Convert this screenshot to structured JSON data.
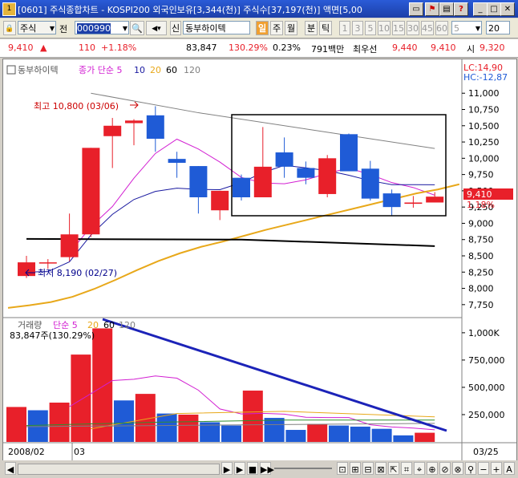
{
  "window": {
    "title": "[0601] 주식종합차트 - KOSPI200 외국인보유[3,344(천)] 주식수[37,197(천)] 액면[5,00",
    "icon": "1",
    "controls": [
      "_",
      "□",
      "✕"
    ],
    "extra_icons": [
      "restore-icon",
      "flag-icon",
      "print-icon",
      "help-icon",
      "minimize-icon"
    ]
  },
  "toolbar": {
    "market_select": "주식",
    "prefix_label": "전",
    "code_value": "000990",
    "search_icon": "magnifier-icon",
    "speaker_icon": "speaker-icon",
    "sin_label": "신",
    "stock_name": "동부하이텍",
    "period_buttons": [
      "일",
      "주",
      "월",
      "분",
      "틱"
    ],
    "active_period": "일",
    "interval_buttons": [
      "1",
      "3",
      "5",
      "10",
      "15",
      "30",
      "45",
      "60"
    ],
    "interval_select": "5",
    "count_value": "20"
  },
  "quote": {
    "price": "9,410",
    "arrow": "▲",
    "change": "110",
    "change_pct": "+1.18%",
    "volume": "83,847",
    "vol_ratio": "130.29%",
    "turnover": "0.23%",
    "amount": "791백만",
    "best_label": "최우선",
    "ask": "9,440",
    "bid": "9,410",
    "open_label": "시",
    "open": "9,320"
  },
  "chart": {
    "price_legend": {
      "name": "동부하이텍",
      "ma_label": "종가 단순 5",
      "ma_values": [
        "10",
        "20",
        "60",
        "120"
      ]
    },
    "vol_legend": {
      "name": "거래량",
      "ma_label": "단순 5",
      "ma_values": [
        "20",
        "60",
        "120"
      ],
      "info": "83,847주(130.29%)"
    },
    "lc_label": "LC:14,90",
    "hc_label": "HC:-12,87",
    "current_price_tag": "9,410",
    "current_pct_tag": "1.18%",
    "high_annotation": "최고 10,800 (03/06)",
    "low_annotation": "최저 8,190 (02/27)",
    "x_labels": [
      "2008/02",
      "03",
      "03/25"
    ],
    "price_ticks": [
      "11,000",
      "10,750",
      "10,500",
      "10,250",
      "10,000",
      "9,750",
      "9,500",
      "9,250",
      "9,000",
      "8,750",
      "8,500",
      "8,250",
      "8,000",
      "7,750"
    ],
    "vol_ticks": [
      "1,000K",
      "750,000",
      "500,000",
      "250,000"
    ],
    "colors": {
      "up": "#e8202a",
      "down": "#1f5bd6",
      "ma5": "#d21fd2",
      "ma10": "#1a1aa0",
      "ma20": "#e8a81a",
      "ma60": "#808080",
      "ma120": "#000000",
      "trend": "#1c23b8"
    }
  },
  "chart_data": {
    "type": "candlestick",
    "candles": [
      {
        "o": 8190,
        "h": 8500,
        "l": 8160,
        "c": 8400
      },
      {
        "o": 8400,
        "h": 8450,
        "l": 8300,
        "c": 8400
      },
      {
        "o": 8480,
        "h": 9150,
        "l": 8420,
        "c": 8830
      },
      {
        "o": 8830,
        "h": 10160,
        "l": 8790,
        "c": 10160
      },
      {
        "o": 10340,
        "h": 10620,
        "l": 9850,
        "c": 10500
      },
      {
        "o": 10540,
        "h": 10600,
        "l": 10200,
        "c": 10580
      },
      {
        "o": 10660,
        "h": 10800,
        "l": 10100,
        "c": 10300
      },
      {
        "o": 9990,
        "h": 10100,
        "l": 9700,
        "c": 9930
      },
      {
        "o": 9880,
        "h": 9880,
        "l": 9150,
        "c": 9400
      },
      {
        "o": 9200,
        "h": 9500,
        "l": 9050,
        "c": 9500
      },
      {
        "o": 9700,
        "h": 9750,
        "l": 9350,
        "c": 9400
      },
      {
        "o": 9400,
        "h": 10480,
        "l": 9400,
        "c": 9870
      },
      {
        "o": 10090,
        "h": 10320,
        "l": 9700,
        "c": 9870
      },
      {
        "o": 9850,
        "h": 9950,
        "l": 9600,
        "c": 9700
      },
      {
        "o": 9450,
        "h": 10050,
        "l": 9400,
        "c": 10000
      },
      {
        "o": 10370,
        "h": 10380,
        "l": 9800,
        "c": 9800
      },
      {
        "o": 9840,
        "h": 9960,
        "l": 9350,
        "c": 9380
      },
      {
        "o": 9460,
        "h": 9520,
        "l": 9120,
        "c": 9250
      },
      {
        "o": 9300,
        "h": 9420,
        "l": 9240,
        "c": 9320
      },
      {
        "o": 9320,
        "h": 9480,
        "l": 9320,
        "c": 9410
      }
    ],
    "volume": [
      {
        "v": 320000,
        "up": true
      },
      {
        "v": 290000,
        "up": false
      },
      {
        "v": 360000,
        "up": true
      },
      {
        "v": 800000,
        "up": true
      },
      {
        "v": 1040000,
        "up": true
      },
      {
        "v": 380000,
        "up": false
      },
      {
        "v": 440000,
        "up": true
      },
      {
        "v": 260000,
        "up": false
      },
      {
        "v": 250000,
        "up": true
      },
      {
        "v": 180000,
        "up": false
      },
      {
        "v": 150000,
        "up": false
      },
      {
        "v": 470000,
        "up": true
      },
      {
        "v": 220000,
        "up": false
      },
      {
        "v": 110000,
        "up": false
      },
      {
        "v": 165000,
        "up": true
      },
      {
        "v": 150000,
        "up": false
      },
      {
        "v": 140000,
        "up": false
      },
      {
        "v": 120000,
        "up": false
      },
      {
        "v": 60000,
        "up": false
      },
      {
        "v": 84000,
        "up": true
      }
    ],
    "price_ylim": [
      7600,
      11200
    ],
    "volume_ylim": [
      0,
      1080000
    ]
  }
}
